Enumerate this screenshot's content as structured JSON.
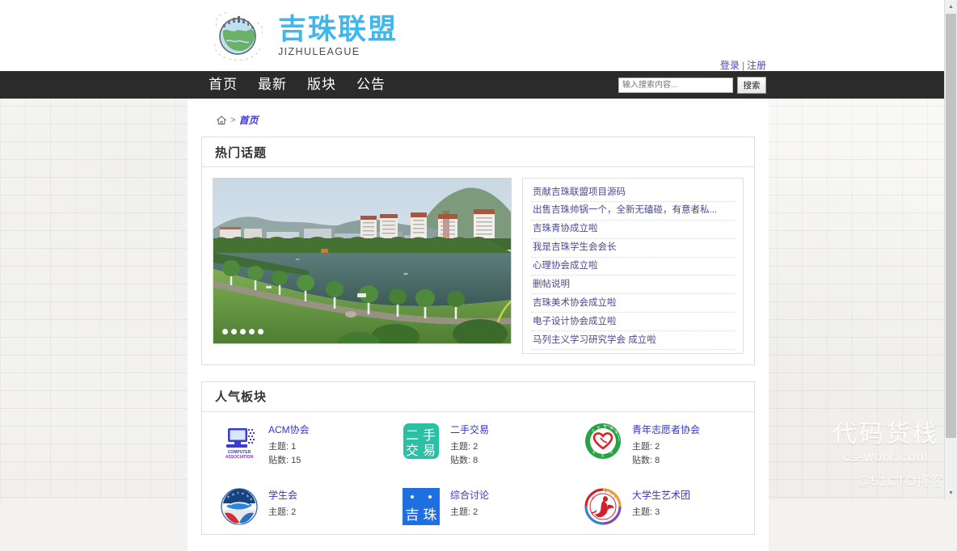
{
  "site": {
    "brand_cn": "吉珠联盟",
    "brand_en": "JIZHULEAGUE",
    "logo_icon": "globe-city-icon"
  },
  "auth": {
    "login_label": "登录",
    "separator": "|",
    "register_label": "注册"
  },
  "nav": {
    "items": [
      {
        "label": "首页"
      },
      {
        "label": "最新"
      },
      {
        "label": "版块"
      },
      {
        "label": "公告"
      }
    ]
  },
  "search": {
    "placeholder": "输入搜索内容...",
    "value": "",
    "button_label": "搜索"
  },
  "breadcrumb": {
    "home_icon": "home-icon",
    "separator": ">",
    "current": "首页"
  },
  "hot_topics": {
    "title": "热门话题",
    "carousel": {
      "image_alt": "campus-lake-photo",
      "dot_count": 5,
      "active_dot": 1
    },
    "items": [
      {
        "title": "贡献吉珠联盟项目源码"
      },
      {
        "title": "出售吉珠帅锅一个，全新无磕碰，有意者私..."
      },
      {
        "title": "吉珠青协成立啦"
      },
      {
        "title": "我是吉珠学生会会长"
      },
      {
        "title": "心理协会成立啦"
      },
      {
        "title": "删帖说明"
      },
      {
        "title": "吉珠美术协会成立啦"
      },
      {
        "title": "电子设计协会成立啦"
      },
      {
        "title": "马列主义学习研究学会 成立啦"
      }
    ]
  },
  "popular_boards": {
    "title": "人气板块",
    "labels": {
      "threads": "主题:",
      "posts": "贴数:"
    },
    "items": [
      {
        "name": "ACM协会",
        "icon": "computer-association-icon",
        "threads": "1",
        "posts": "15",
        "icon_color": "#3b3bd0"
      },
      {
        "name": "二手交易",
        "icon": "secondhand-trade-icon",
        "threads": "2",
        "posts": "8",
        "icon_color": "#2bbfa3"
      },
      {
        "name": "青年志愿者协会",
        "icon": "volunteer-heart-icon",
        "threads": "2",
        "posts": "8",
        "icon_color": "#25a244"
      },
      {
        "name": "学生会",
        "icon": "student-union-icon",
        "threads": "2",
        "posts": "",
        "icon_color": "#1f5fb0"
      },
      {
        "name": "综合讨论",
        "icon": "jizhu-general-icon",
        "threads": "2",
        "posts": "",
        "icon_color": "#1f6fe0"
      },
      {
        "name": "大学生艺术团",
        "icon": "art-troupe-icon",
        "threads": "3",
        "posts": "",
        "icon_color": "#d0202a"
      }
    ]
  },
  "watermark": {
    "line1": "代码货栈",
    "line2": "cs-work.com",
    "cto": "@51CTO博客"
  },
  "colors": {
    "brand_blue": "#3db8ef",
    "nav_bg": "#2b2b2b",
    "link_blue": "#3535c9",
    "auth_purple": "#5b3fb8"
  }
}
